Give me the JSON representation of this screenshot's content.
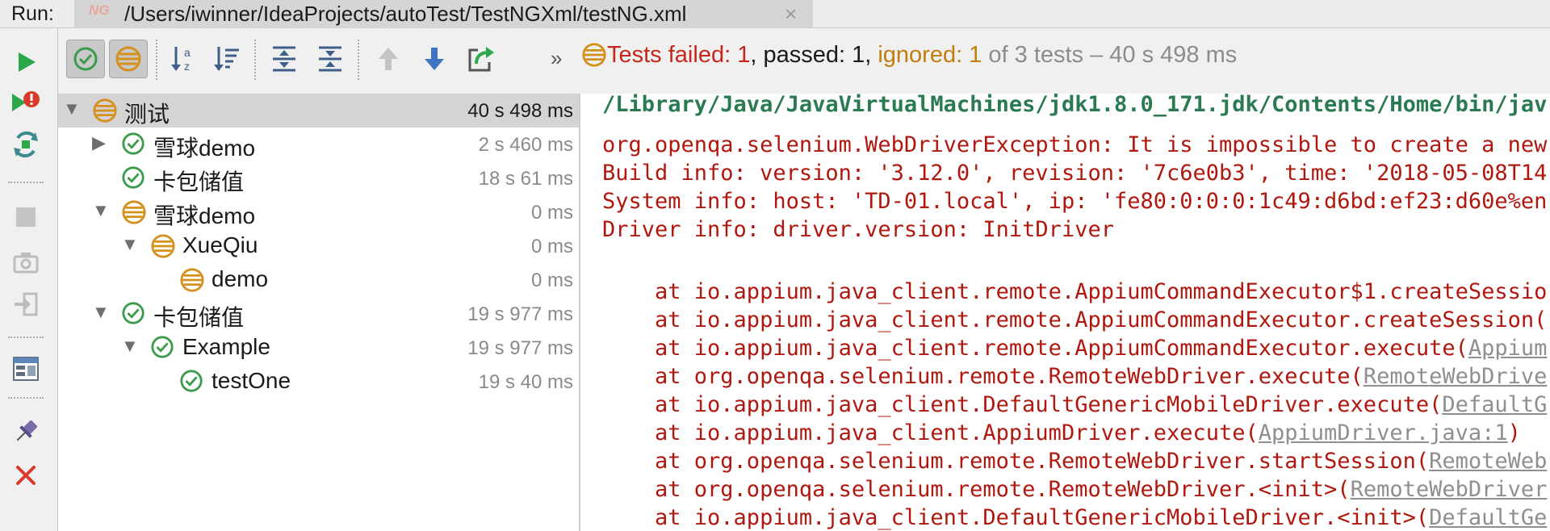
{
  "header": {
    "run_label": "Run:",
    "tab_icon_text": "NG",
    "tab_title": "/Users/iwinner/IdeaProjects/autoTest/TestNGXml/testNG.xml",
    "tab_close": "×"
  },
  "left_toolbar": {
    "buttons": [
      "rerun-icon",
      "rerun-failed-icon",
      "toggle-auto-test-icon",
      "stop-icon",
      "screenshot-icon",
      "import-icon",
      "restore-layout-icon",
      "pin-icon",
      "close-icon"
    ]
  },
  "main_toolbar": {
    "buttons": [
      "show-passed-icon",
      "show-ignored-icon",
      "sort-alphabetically-icon",
      "sort-by-duration-icon",
      "expand-all-icon",
      "collapse-all-icon",
      "previous-failed-icon",
      "next-failed-icon",
      "export-icon"
    ],
    "more_label": "»",
    "status": {
      "prefix": "Tests failed: ",
      "failed": "1",
      "passed_text": ", passed: 1, ",
      "ignored_text": "ignored: 1",
      "total_text": " of 3 tests",
      "duration_text": " – 40 s 498 ms"
    }
  },
  "colors": {
    "passed": "#3b9b4a",
    "ignored": "#d5901e",
    "failed": "#c7271b",
    "run_green": "#2ca84a"
  },
  "tree": [
    {
      "label": "测试",
      "time": "40 s 498 ms",
      "status": "ignored",
      "expanded": true,
      "selected": true
    },
    {
      "label": "雪球demo",
      "time": "2 s 460 ms",
      "status": "passed",
      "expanded": false
    },
    {
      "label": "卡包储值",
      "time": "18 s 61 ms",
      "status": "passed"
    },
    {
      "label": "雪球demo",
      "time": "0 ms",
      "status": "ignored",
      "expanded": true
    },
    {
      "label": "XueQiu",
      "time": "0 ms",
      "status": "ignored",
      "expanded": true
    },
    {
      "label": "demo",
      "time": "0 ms",
      "status": "ignored"
    },
    {
      "label": "卡包储值",
      "time": "19 s 977 ms",
      "status": "passed",
      "expanded": true
    },
    {
      "label": "Example",
      "time": "19 s 977 ms",
      "status": "passed",
      "expanded": true
    },
    {
      "label": "testOne",
      "time": "19 s 40 ms",
      "status": "passed"
    }
  ],
  "console": {
    "command": "/Library/Java/JavaVirtualMachines/jdk1.8.0_171.jdk/Contents/Home/bin/jav",
    "lines": [
      "org.openqa.selenium.WebDriverException: It is impossible to create a new",
      "Build info: version: '3.12.0', revision: '7c6e0b3', time: '2018-05-08T14",
      "System info: host: 'TD-01.local', ip: 'fe80:0:0:0:1c49:d6bd:ef23:d60e%en",
      "Driver info: driver.version: InitDriver"
    ],
    "stack": [
      {
        "text": "    at io.appium.java_client.remote.AppiumCommandExecutor$1.createSessio",
        "link": ""
      },
      {
        "text": "    at io.appium.java_client.remote.AppiumCommandExecutor.createSession(",
        "link": ""
      },
      {
        "text": "    at io.appium.java_client.remote.AppiumCommandExecutor.execute(",
        "link": "Appium"
      },
      {
        "text": "    at org.openqa.selenium.remote.RemoteWebDriver.execute(",
        "link": "RemoteWebDrive"
      },
      {
        "text": "    at io.appium.java_client.DefaultGenericMobileDriver.execute(",
        "link": "DefaultG"
      },
      {
        "text": "    at io.appium.java_client.AppiumDriver.execute(",
        "link": "AppiumDriver.java:1",
        "tail": ")"
      },
      {
        "text": "    at org.openqa.selenium.remote.RemoteWebDriver.startSession(",
        "link": "RemoteWeb"
      },
      {
        "text": "    at org.openqa.selenium.remote.RemoteWebDriver.<init>(",
        "link": "RemoteWebDriver"
      },
      {
        "text": "    at io.appium.java_client.DefaultGenericMobileDriver.<init>(",
        "link": "DefaultGe"
      }
    ]
  }
}
